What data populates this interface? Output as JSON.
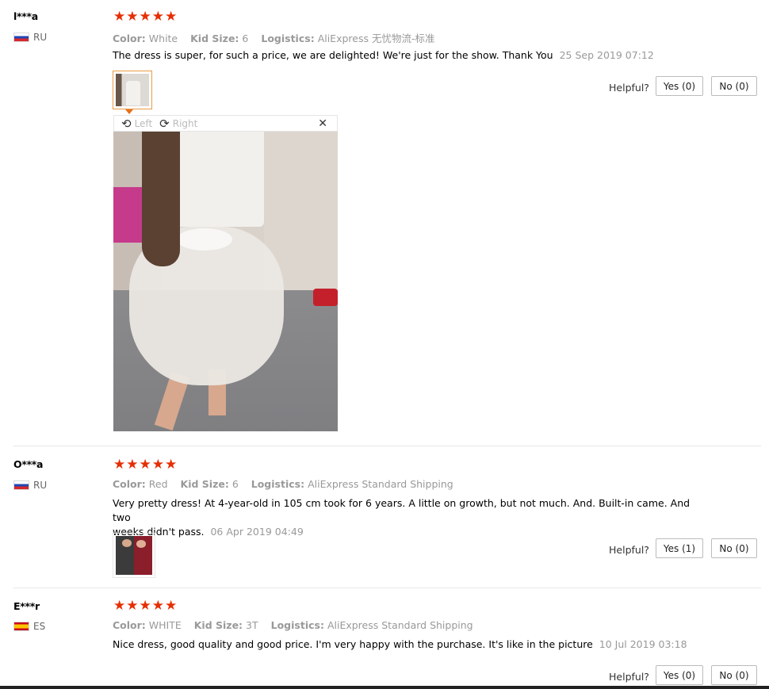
{
  "reviews": [
    {
      "user": "l***a",
      "country": "RU",
      "stars": 5,
      "color_label": "Color:",
      "color_value": "White",
      "size_label": "Kid Size:",
      "size_value": "6",
      "logistics_label": "Logistics:",
      "logistics_value": "AliExpress 无忧物流-标准",
      "text": "The dress is super, for such a price, we are delighted! We're just for the show. Thank You",
      "date": "25 Sep 2019 07:12",
      "helpful_label": "Helpful?",
      "yes_label": "Yes (0)",
      "no_label": "No (0)"
    },
    {
      "user": "O***a",
      "country": "RU",
      "stars": 5,
      "color_label": "Color:",
      "color_value": "Red",
      "size_label": "Kid Size:",
      "size_value": "6",
      "logistics_label": "Logistics:",
      "logistics_value": "AliExpress Standard Shipping",
      "text_line1": "Very pretty dress! At 4-year-old in 105 cm took for 6 years. A little on growth, but not much. And. Built-in came. And two",
      "text_line2": "weeks didn't pass.",
      "date": "06 Apr 2019 04:49",
      "helpful_label": "Helpful?",
      "yes_label": "Yes (1)",
      "no_label": "No (0)"
    },
    {
      "user": "E***r",
      "country": "ES",
      "stars": 5,
      "color_label": "Color:",
      "color_value": "WHITE",
      "size_label": "Kid Size:",
      "size_value": "3T",
      "logistics_label": "Logistics:",
      "logistics_value": "AliExpress Standard Shipping",
      "text": "Nice dress, good quality and good price. I'm very happy with the purchase. It's like in the picture",
      "date": "10 Jul 2019 03:18",
      "helpful_label": "Helpful?",
      "yes_label": "Yes (0)",
      "no_label": "No (0)"
    }
  ],
  "image_viewer": {
    "rotate_left_label": "Left",
    "rotate_right_label": "Right",
    "close_glyph": "✕"
  },
  "icons": {
    "star": "★",
    "rotate_left": "⟲",
    "rotate_right": "⟳"
  },
  "colors": {
    "star": "#e62e04",
    "thumb_border_active": "#e89b45"
  }
}
